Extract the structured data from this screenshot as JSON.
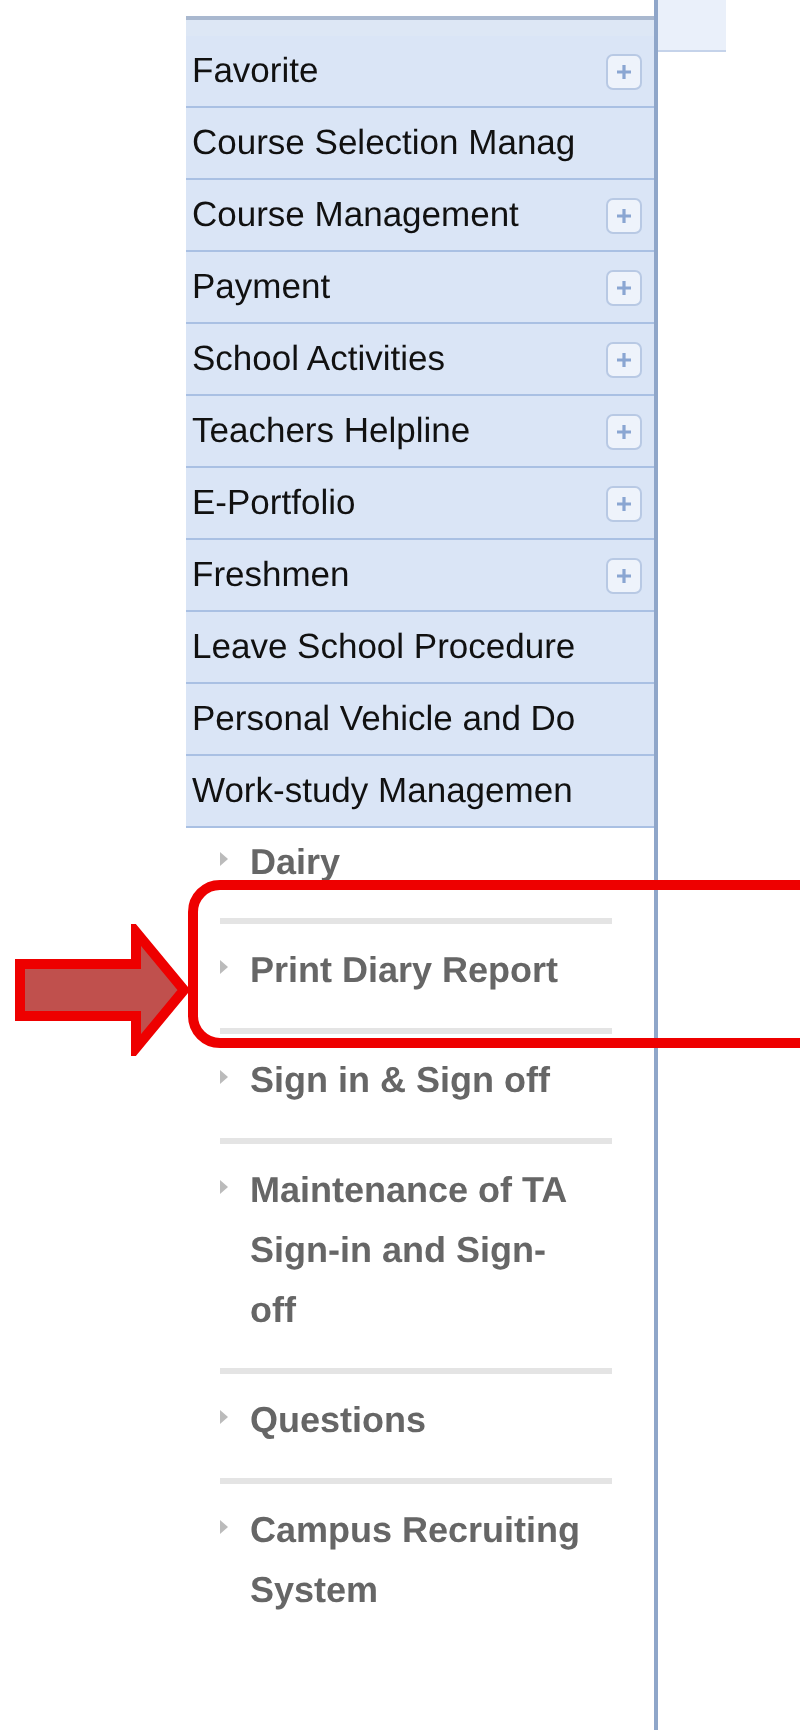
{
  "menu": [
    {
      "label": "Favorite",
      "expandable": true
    },
    {
      "label": "Course Selection Manag",
      "expandable": false
    },
    {
      "label": "Course Management",
      "expandable": true
    },
    {
      "label": "Payment",
      "expandable": true
    },
    {
      "label": "School Activities",
      "expandable": true
    },
    {
      "label": "Teachers Helpline",
      "expandable": true
    },
    {
      "label": "E-Portfolio",
      "expandable": true
    },
    {
      "label": "Freshmen",
      "expandable": true
    },
    {
      "label": "Leave School Procedure",
      "expandable": false
    },
    {
      "label": "Personal Vehicle and Do",
      "expandable": false
    },
    {
      "label": "Work-study Managemen",
      "expandable": false
    }
  ],
  "submenu": [
    {
      "label": "Dairy",
      "marked": false
    },
    {
      "label": "Print Diary Report",
      "marked": true
    },
    {
      "label": "Sign in & Sign off",
      "marked": false
    },
    {
      "label": "Maintenance of TA Sign-in and Sign-off",
      "marked": false
    },
    {
      "label": "Questions",
      "marked": false
    },
    {
      "label": "Campus Recruiting System",
      "marked": false
    }
  ]
}
